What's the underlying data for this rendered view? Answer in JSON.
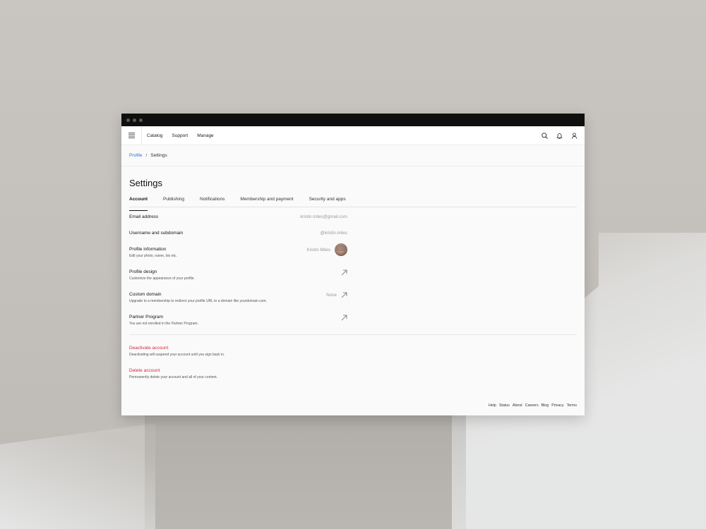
{
  "window": {
    "dots": [
      "close",
      "minimize",
      "maximize"
    ]
  },
  "nav": {
    "items": [
      "Catalog",
      "Support",
      "Manage"
    ],
    "icons": [
      "search-icon",
      "bell-icon",
      "user-icon"
    ]
  },
  "breadcrumb": {
    "link": "Profile",
    "separator": "/",
    "current": "Settings"
  },
  "page": {
    "title": "Settings"
  },
  "tabs": [
    {
      "label": "Account",
      "active": true
    },
    {
      "label": "Publishing",
      "active": false
    },
    {
      "label": "Notifications",
      "active": false
    },
    {
      "label": "Membership and payment",
      "active": false
    },
    {
      "label": "Security and apps",
      "active": false
    }
  ],
  "account": {
    "email": {
      "label": "Email address",
      "value": "kristin.miles@gmail.com"
    },
    "username": {
      "label": "Username and subdomain",
      "value": "@kristin.miles"
    },
    "profile_info": {
      "label": "Profile information",
      "desc": "Edit your photo, name, bio etc.",
      "value": "Kristin Miles"
    },
    "profile_design": {
      "label": "Profile design",
      "desc": "Customize the appearance of your profile."
    },
    "custom_domain": {
      "label": "Custom domain",
      "desc": "Upgrade to a membership to redirect your profile URL to a domain like yourdomain.com.",
      "value": "None"
    },
    "partner": {
      "label": "Partner Program",
      "desc": "You are not enrolled in the Partner Program."
    }
  },
  "danger": {
    "deactivate": {
      "label": "Deactivate account",
      "desc": "Deactivating will suspend your account until you sign back in."
    },
    "delete": {
      "label": "Delete account",
      "desc": "Permanently delete your account and all of your content."
    }
  },
  "footer": [
    "Help",
    "Status",
    "About",
    "Careers",
    "Blog",
    "Privacy",
    "Terms"
  ],
  "colors": {
    "link": "#2e6fd8",
    "danger": "#d1293d",
    "titlebar": "#0f0f0f"
  }
}
